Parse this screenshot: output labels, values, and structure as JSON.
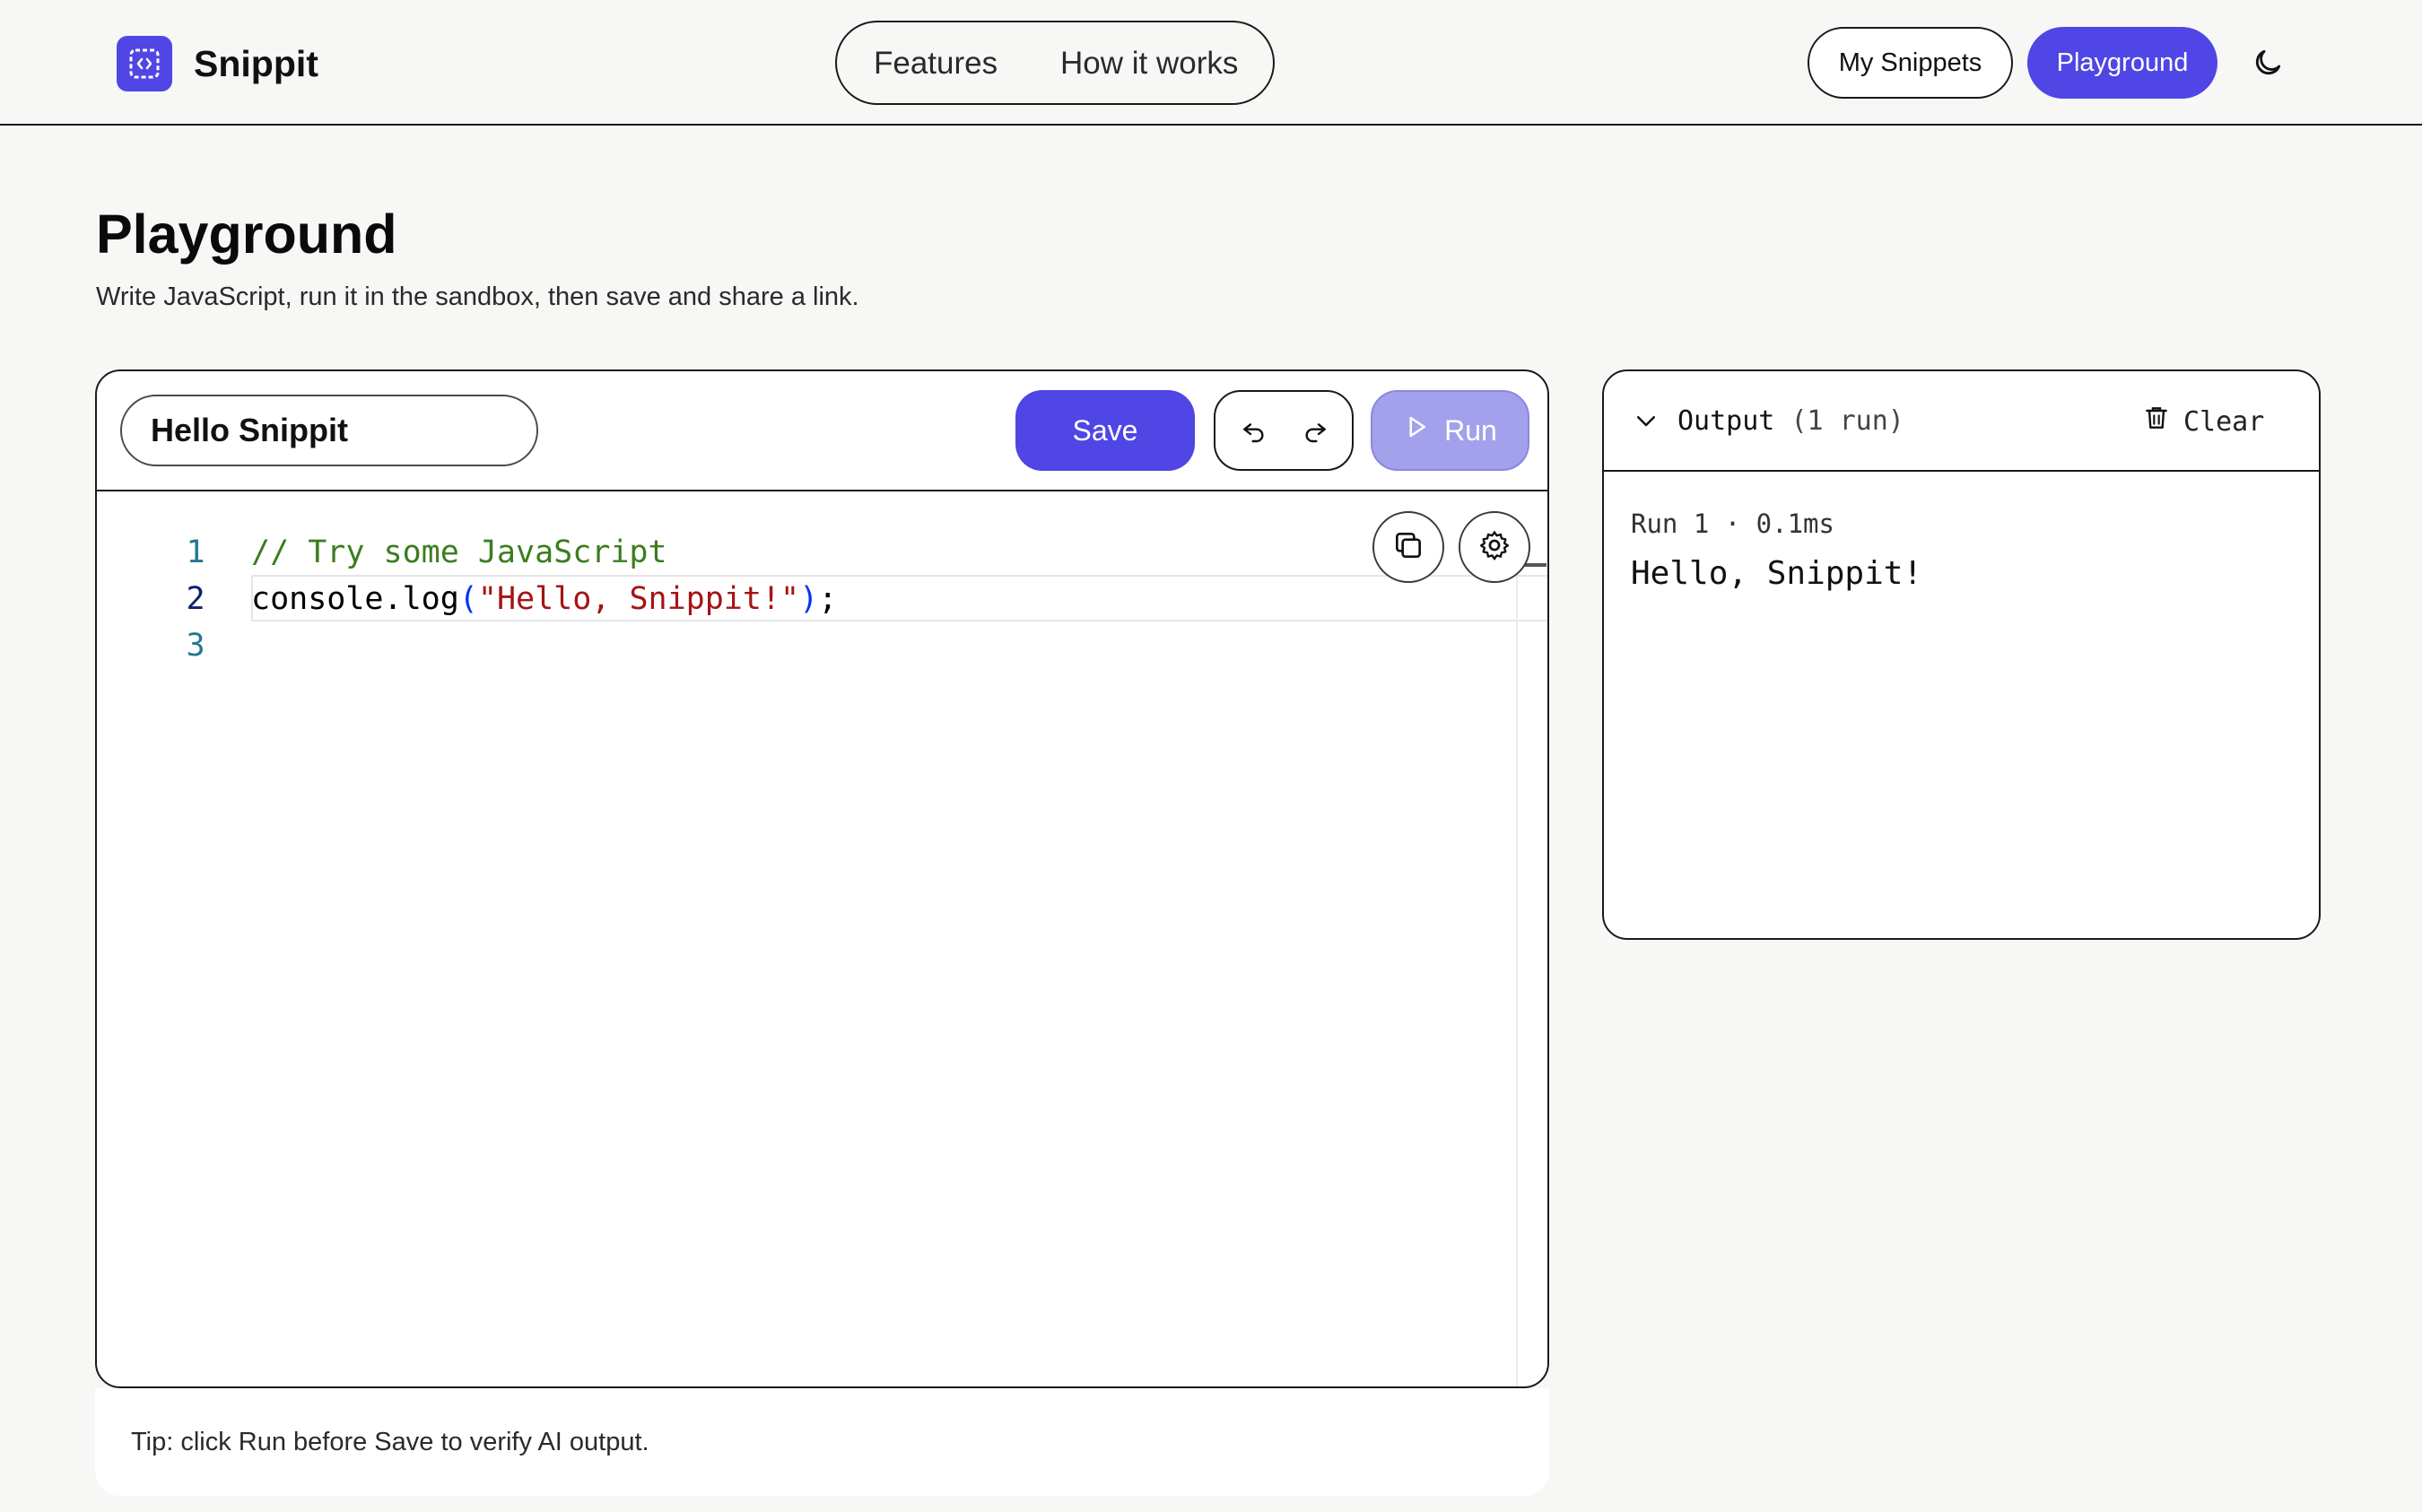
{
  "header": {
    "brand": "Snippit",
    "nav": [
      "Features",
      "How it works"
    ],
    "my_snippets_label": "My Snippets",
    "playground_label": "Playground",
    "icons": {
      "logo": "code-brackets-icon",
      "theme": "moon-icon"
    },
    "accent_color": "#4f46e5"
  },
  "page": {
    "title": "Playground",
    "subtitle": "Write JavaScript, run it in the sandbox, then save and share a link."
  },
  "editor": {
    "snippet_title": "Hello Snippit",
    "save_label": "Save",
    "run_label": "Run",
    "icons": {
      "undo": "undo-icon",
      "redo": "redo-icon",
      "run": "play-icon",
      "copy": "copy-icon",
      "settings": "gear-icon"
    },
    "line_numbers": [
      "1",
      "2",
      "3"
    ],
    "code": {
      "line1_comment": "// Try some JavaScript",
      "line2_call": "console.log",
      "line2_open": "(",
      "line2_string": "\"Hello, Snippit!\"",
      "line2_close": ")",
      "line2_end": ";"
    }
  },
  "tip": "Tip: click Run before Save to verify AI output.",
  "output": {
    "title": "Output",
    "count": "(1 run)",
    "clear_label": "Clear",
    "icons": {
      "collapse": "chevron-down-icon",
      "clear": "trash-icon"
    },
    "runs": [
      {
        "meta": "Run 1 · 0.1ms",
        "text": "Hello, Snippit!"
      }
    ]
  }
}
